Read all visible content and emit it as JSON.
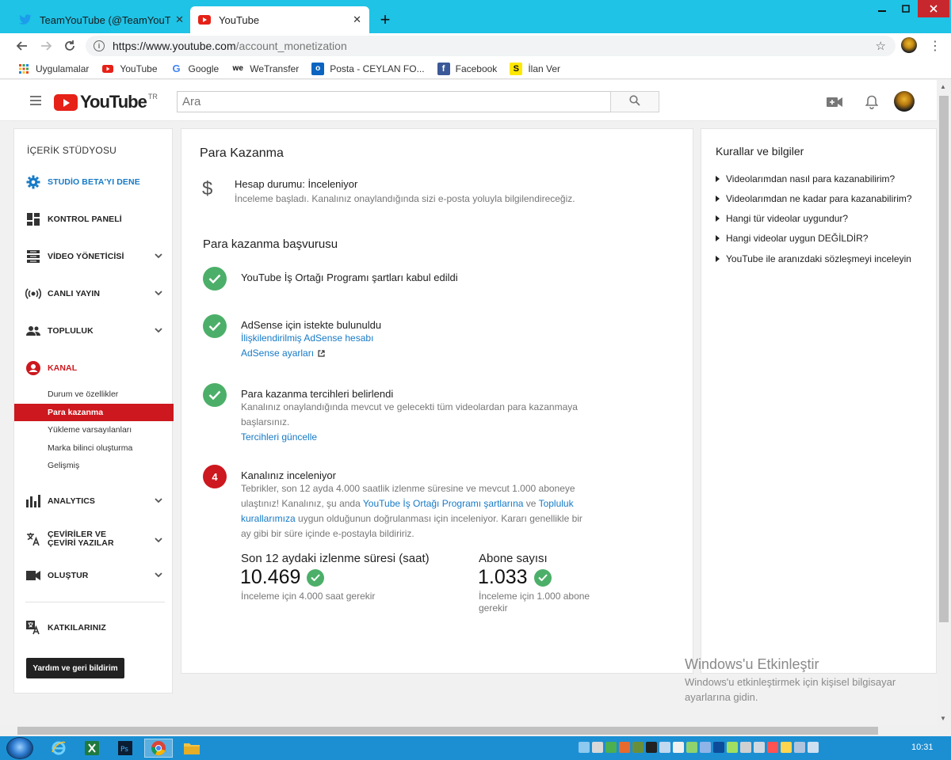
{
  "browser": {
    "tabs": [
      {
        "label": "TeamYouTube (@TeamYouTube)",
        "close": "✕"
      },
      {
        "label": "YouTube",
        "close": "✕"
      }
    ],
    "new_tab": "+",
    "url_host": "https://www.youtube.com",
    "url_path": "/account_monetization",
    "bookmarks": [
      {
        "label": "Uygulamalar"
      },
      {
        "label": "YouTube"
      },
      {
        "label": "Google"
      },
      {
        "label": "WeTransfer"
      },
      {
        "label": "Posta - CEYLAN FO..."
      },
      {
        "label": "Facebook"
      },
      {
        "label": "İlan Ver"
      }
    ]
  },
  "header": {
    "logo_text": "YouTube",
    "country": "TR",
    "search_placeholder": "Ara"
  },
  "sidebar": {
    "title": "İÇERİK STÜDYOSU",
    "items": [
      {
        "label": "STUDİO BETA'YI DENE"
      },
      {
        "label": "KONTROL PANELİ"
      },
      {
        "label": "VİDEO YÖNETİCİSİ"
      },
      {
        "label": "CANLI YAYIN"
      },
      {
        "label": "TOPLULUK"
      },
      {
        "label": "KANAL"
      },
      {
        "label": "ANALYTICS"
      },
      {
        "label": "ÇEVİRİLER VE ÇEVİRİ YAZILAR"
      },
      {
        "label": "OLUŞTUR"
      },
      {
        "label": "KATKILARINIZ"
      }
    ],
    "channel_sub": [
      {
        "label": "Durum ve özellikler"
      },
      {
        "label": "Para kazanma"
      },
      {
        "label": "Yükleme varsayılanları"
      },
      {
        "label": "Marka bilinci oluşturma"
      },
      {
        "label": "Gelişmiş"
      }
    ],
    "help_button": "Yardım ve geri bildirim"
  },
  "main": {
    "title": "Para Kazanma",
    "account_status": "Hesap durumu: İnceleniyor",
    "account_desc": "İnceleme başladı. Kanalınız onaylandığında sizi e-posta yoluyla bilgilendireceğiz.",
    "application_title": "Para kazanma başvurusu",
    "step1": {
      "title": "YouTube İş Ortağı Programı şartları kabul edildi"
    },
    "step2": {
      "title": "AdSense için istekte bulunuldu",
      "link1": "İlişkilendirilmiş AdSense hesabı",
      "link2": "AdSense ayarları"
    },
    "step3": {
      "title": "Para kazanma tercihleri belirlendi",
      "line1": "Kanalınız onaylandığında mevcut ve gelecekti tüm videolardan para kazanmaya",
      "line2": "başlarsınız.",
      "link": "Tercihleri güncelle"
    },
    "step4": {
      "number": "4",
      "title": "Kanalınız inceleniyor",
      "line1": "Tebrikler, son 12 ayda 4.000 saatlik izlenme süresine ve mevcut 1.000 aboneye",
      "line2_a": "ulaştınız! Kanalınız, şu anda ",
      "line2_link1": "YouTube İş Ortağı Programı şartlarına",
      "line2_b": " ve ",
      "line2_link2": "Topluluk",
      "line3_link": "kurallarımıza",
      "line3_b": " uygun olduğunun doğrulanması için inceleniyor. Kararı genellikle bir",
      "line4": "ay gibi bir süre içinde e-postayla bildiririz."
    },
    "stats": [
      {
        "label": "Son 12 aydaki izlenme süresi (saat)",
        "value": "10.469",
        "note": "İnceleme için 4.000 saat gerekir"
      },
      {
        "label": "Abone sayısı",
        "value": "1.033",
        "note_line1": "İnceleme için 1.000 abone",
        "note_line2": "gerekir"
      }
    ]
  },
  "rules": {
    "title": "Kurallar ve bilgiler",
    "items": [
      {
        "label": "Videolarımdan nasıl para kazanabilirim?"
      },
      {
        "label": "Videolarımdan ne kadar para kazanabilirim?"
      },
      {
        "label": "Hangi tür videolar uygundur?"
      },
      {
        "label": "Hangi videolar uygun DEĞİLDİR?"
      },
      {
        "label": "YouTube ile aranızdaki sözleşmeyi inceleyin"
      }
    ]
  },
  "activation": {
    "line1": "Windows'u Etkinleştir",
    "line2": "Windows'u etkinleştirmek için kişisel bilgisayar",
    "line3": "ayarlarına gidin."
  },
  "taskbar": {
    "clock": "10:31"
  },
  "colors": {
    "accent_red": "#cc181e",
    "link_blue": "#167ac6",
    "success_green": "#4caf69",
    "titlebar": "#1ec3e6"
  }
}
